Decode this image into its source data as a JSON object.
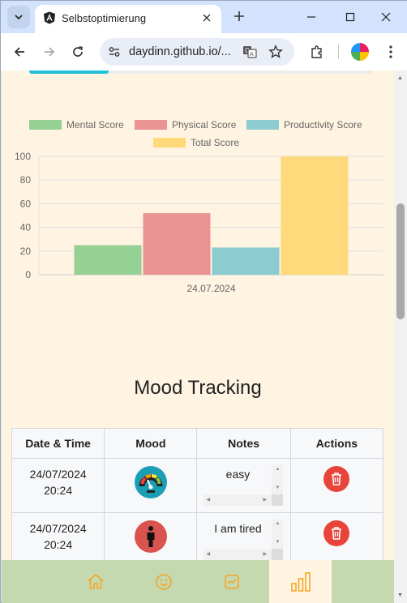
{
  "browser": {
    "tab_title": "Selbstoptimierung",
    "url": "daydinn.github.io/..."
  },
  "chart_data": {
    "type": "bar",
    "categories": [
      "24.07.2024"
    ],
    "series": [
      {
        "name": "Mental Score",
        "values": [
          25
        ],
        "color": "#95d095"
      },
      {
        "name": "Physical Score",
        "values": [
          52
        ],
        "color": "#eb9292"
      },
      {
        "name": "Productivity Score",
        "values": [
          23
        ],
        "color": "#8ccbcf"
      },
      {
        "name": "Total Score",
        "values": [
          100
        ],
        "color": "#ffd97a"
      }
    ],
    "yticks": [
      "0",
      "20",
      "40",
      "60",
      "80",
      "100"
    ],
    "ylim": [
      0,
      100
    ],
    "grid": true,
    "legend": "top"
  },
  "mood_section": {
    "title": "Mood Tracking",
    "columns": [
      "Date & Time",
      "Mood",
      "Notes",
      "Actions"
    ],
    "rows": [
      {
        "date": "24/07/2024",
        "time": "20:24",
        "mood_icon": "gauge-icon",
        "note": "easy"
      },
      {
        "date": "24/07/2024",
        "time": "20:24",
        "mood_icon": "person-standing-icon",
        "note": "I am tired"
      }
    ]
  },
  "bottom_nav": {
    "items": [
      "home-icon",
      "smiley-icon",
      "activity-icon",
      "bar-chart-icon"
    ],
    "active": "bar-chart-icon",
    "icon_color": "#f5a623"
  }
}
